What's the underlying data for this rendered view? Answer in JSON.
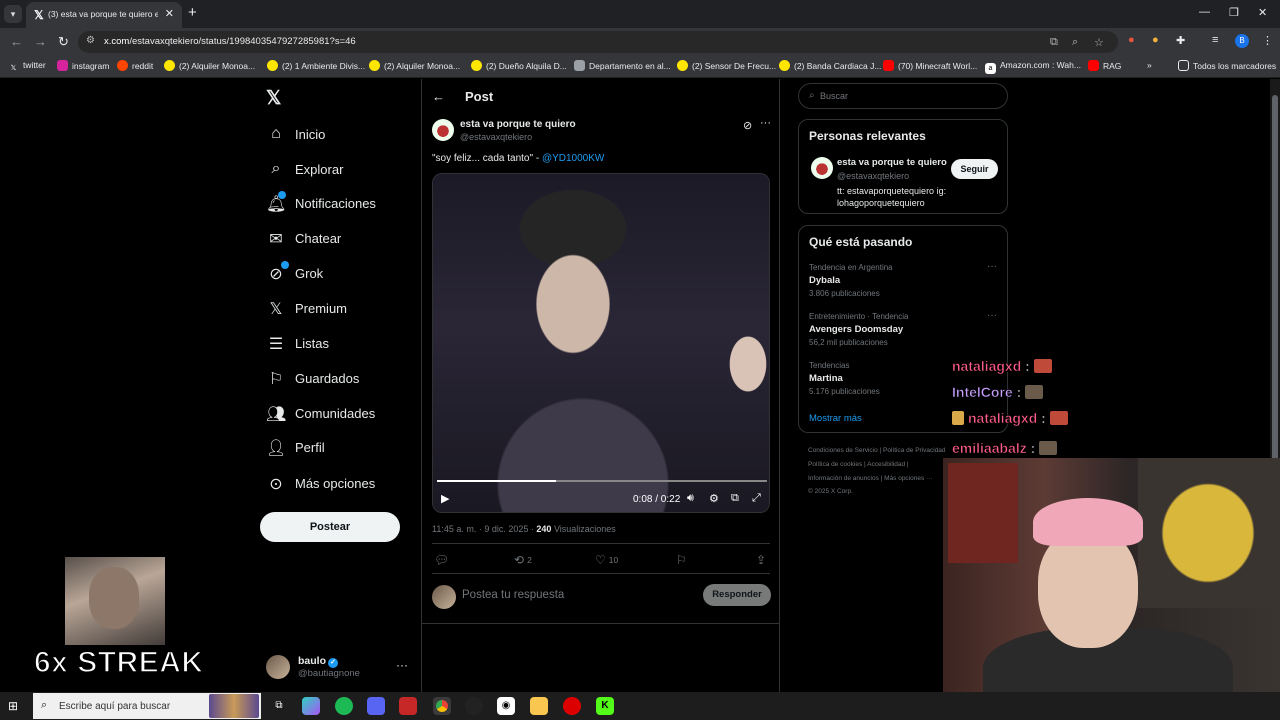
{
  "browser": {
    "tab_title": "(3) esta va porque te quiero en X",
    "url_domain": "x.com",
    "url_path": "/estavaxqtekiero/status/1998403547927285981?s=46",
    "bookmarks": [
      "twitter",
      "instagram",
      "reddit",
      "(2) Alquiler Monoa...",
      "(2) 1 Ambiente Divis...",
      "(2) Alquiler Monoa...",
      "(2) Dueño Alquila D...",
      "Departamento en al...",
      "(2) Sensor De Frecu...",
      "(2) Banda Cardiaca J...",
      "(70) Minecraft Worl...",
      "Amazon.com : Wah...",
      "RAG"
    ],
    "all_bookmarks": "Todos los marcadores",
    "profile_letter": "B"
  },
  "nav": {
    "items": [
      {
        "label": "Inicio",
        "icon": "home-icon"
      },
      {
        "label": "Explorar",
        "icon": "search-icon"
      },
      {
        "label": "Notificaciones",
        "icon": "bell-icon"
      },
      {
        "label": "Chatear",
        "icon": "mail-icon"
      },
      {
        "label": "Grok",
        "icon": "grok-icon"
      },
      {
        "label": "Premium",
        "icon": "x-logo-icon"
      },
      {
        "label": "Listas",
        "icon": "list-icon"
      },
      {
        "label": "Guardados",
        "icon": "bookmark-icon"
      },
      {
        "label": "Comunidades",
        "icon": "people-icon"
      },
      {
        "label": "Perfil",
        "icon": "user-icon"
      },
      {
        "label": "Más opciones",
        "icon": "more-circle-icon"
      }
    ],
    "post_button": "Postear",
    "account_name": "baulo",
    "account_handle": "@bautiagnone"
  },
  "post": {
    "header": "Post",
    "author_name": "esta va porque te quiero",
    "author_handle": "@estavaxqtekiero",
    "text": "\"soy feliz... cada tanto\" - ",
    "mention": "@YD1000KW",
    "video_time": "0:08 / 0:22",
    "video_progress": 0.36,
    "timestamp": "11:45 a. m. · 9 dic. 2025 · ",
    "views_count": "240",
    "views_label": "Visualizaciones",
    "reposts": "2",
    "likes": "10",
    "reply_placeholder": "Postea tu respuesta",
    "reply_button": "Responder"
  },
  "right": {
    "search_placeholder": "Buscar",
    "relevant_title": "Personas relevantes",
    "relevant_name": "esta va porque te quiero",
    "relevant_handle": "@estavaxqtekiero",
    "relevant_bio": "tt: estavaporquetequiero ig: lohagoporquetequiero",
    "follow_button": "Seguir",
    "trending_title": "Qué está pasando",
    "trends": [
      {
        "category": "Tendencia en Argentina",
        "name": "Dybala",
        "posts": "3.806 publicaciones"
      },
      {
        "category": "Entretenimiento · Tendencia",
        "name": "Avengers Doomsday",
        "posts": "56,2 mil publicaciones"
      },
      {
        "category": "Tendencias",
        "name": "Martina",
        "posts": "5.176 publicaciones"
      }
    ],
    "show_more": "Mostrar más",
    "footer_line1": "Condiciones de Servicio  |  Política de Privacidad",
    "footer_line2": "Política de cookies  |  Accesibilidad  |",
    "footer_line3": "Información de anuncios  |  Más opciones ···",
    "footer_line4": "© 2025 X Corp."
  },
  "overlay": {
    "streak": "6x STREAK",
    "chat": [
      {
        "user": "nataliagxd",
        "color": "#ff5c8a"
      },
      {
        "user": "IntelCore",
        "color": "#c8a0ff"
      },
      {
        "user": "nataliagxd",
        "color": "#ff5c8a"
      },
      {
        "user": "emiliaabalz",
        "color": "#ff5c8a"
      }
    ]
  },
  "taskbar": {
    "search_placeholder": "Escribe aquí para buscar"
  },
  "colors": {
    "accent": "#1d9bf0",
    "background": "#000000",
    "border": "#2f3336",
    "muted_text": "#71767b"
  }
}
